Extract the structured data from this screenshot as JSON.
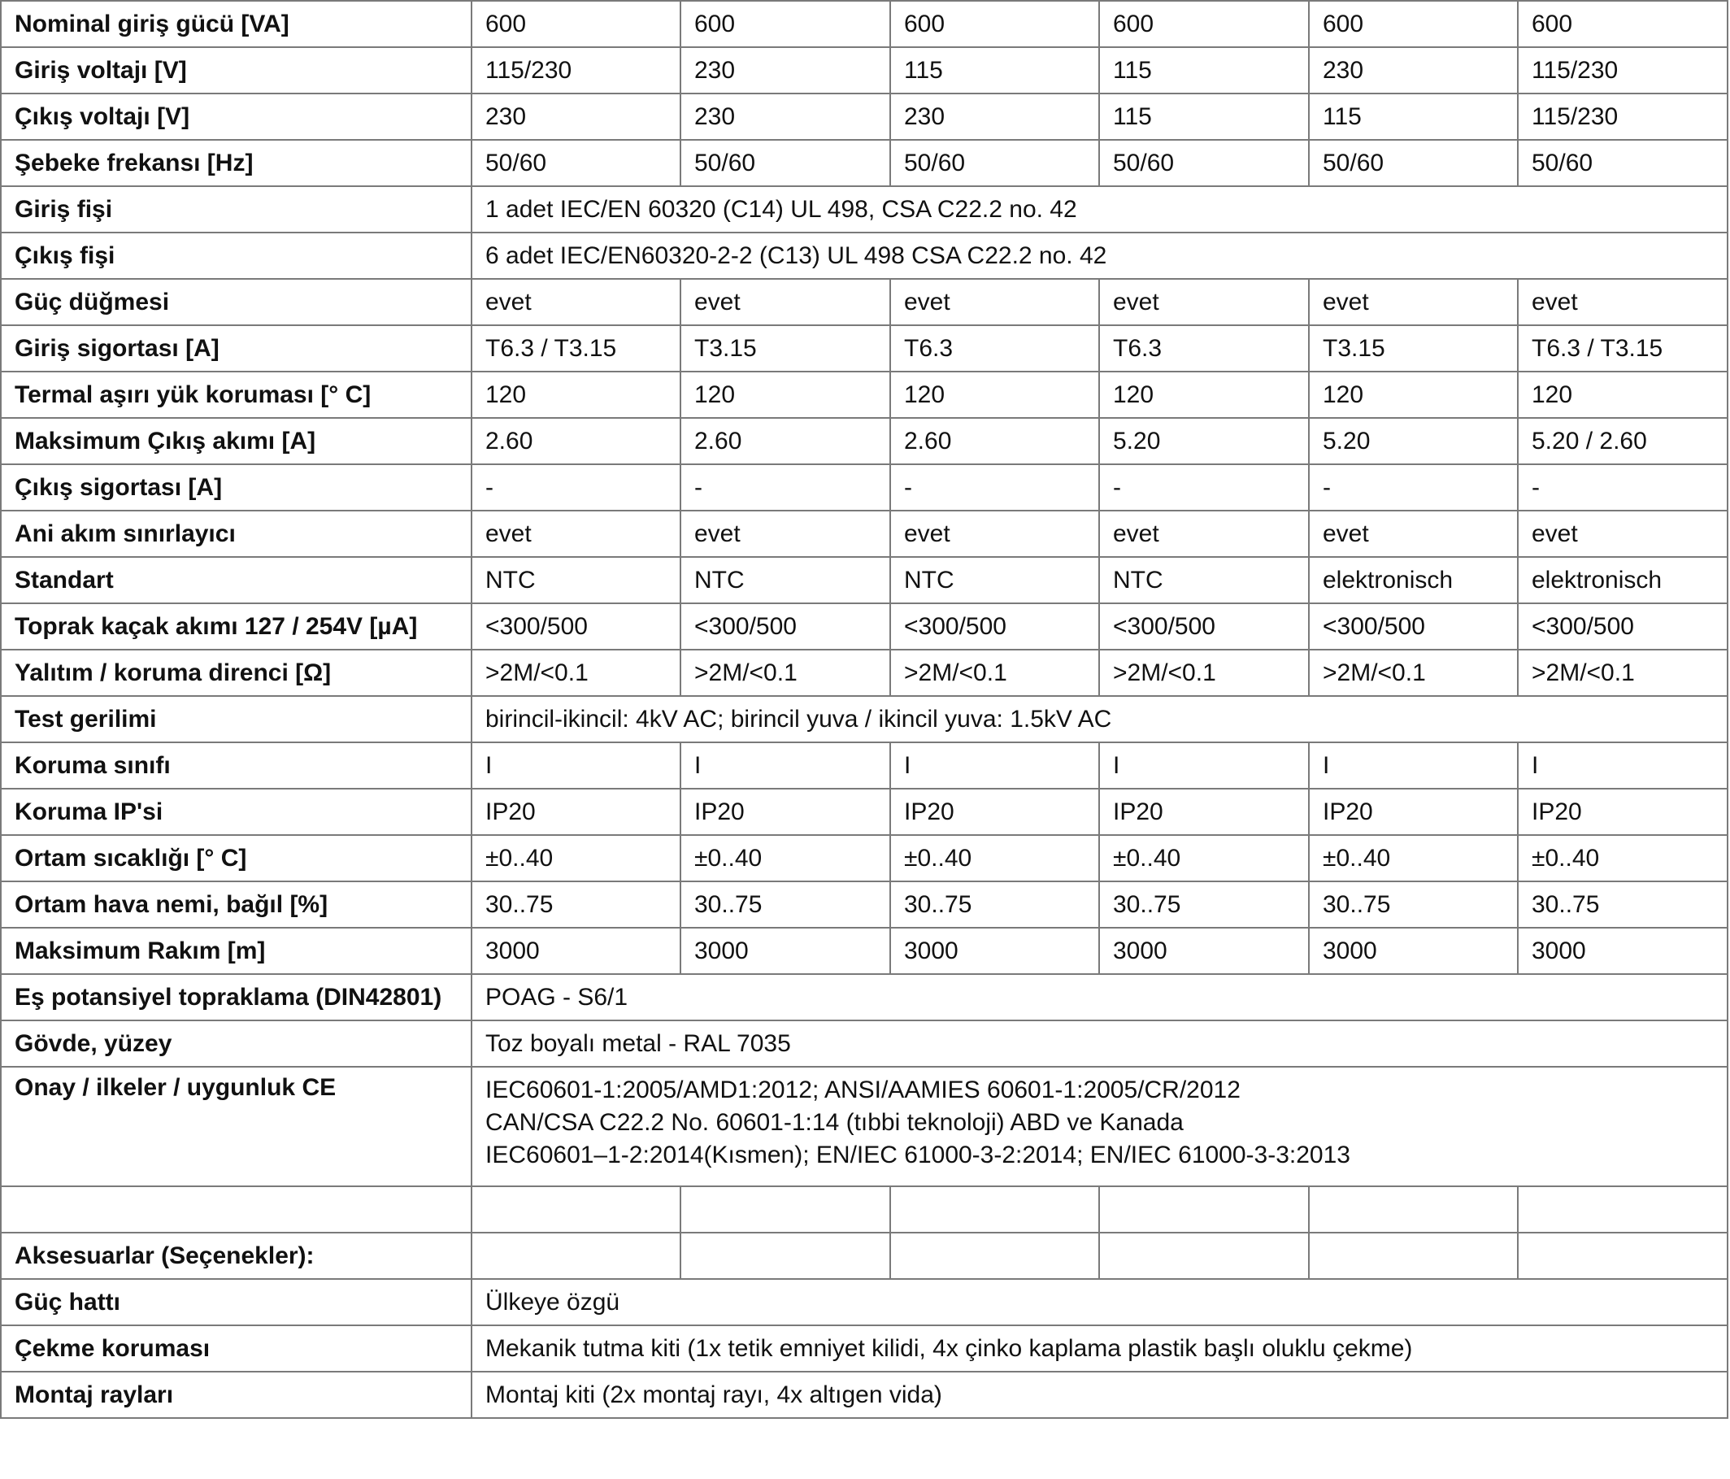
{
  "rows": [
    {
      "label": "Nominal giriş gücü [VA]",
      "values": [
        "600",
        "600",
        "600",
        "600",
        "600",
        "600"
      ]
    },
    {
      "label": "Giriş voltajı [V]",
      "values": [
        "115/230",
        "230",
        "115",
        "115",
        "230",
        "115/230"
      ]
    },
    {
      "label": "Çıkış voltajı [V]",
      "values": [
        "230",
        "230",
        "230",
        "115",
        "115",
        "115/230"
      ]
    },
    {
      "label": "Şebeke frekansı [Hz]",
      "values": [
        "50/60",
        "50/60",
        "50/60",
        "50/60",
        "50/60",
        "50/60"
      ]
    },
    {
      "label": "Giriş fişi",
      "span": "1 adet IEC/EN 60320 (C14) UL 498, CSA C22.2 no. 42"
    },
    {
      "label": "Çıkış fişi",
      "span": "6 adet IEC/EN60320-2-2 (C13) UL 498 CSA C22.2 no. 42"
    },
    {
      "label": "Güç düğmesi",
      "values": [
        "evet",
        "evet",
        "evet",
        "evet",
        "evet",
        "evet"
      ]
    },
    {
      "label": "Giriş sigortası [A]",
      "values": [
        "T6.3 / T3.15",
        "T3.15",
        "T6.3",
        "T6.3",
        "T3.15",
        "T6.3 / T3.15"
      ]
    },
    {
      "label": "Termal aşırı yük koruması [° C]",
      "values": [
        "120",
        "120",
        "120",
        "120",
        "120",
        "120"
      ]
    },
    {
      "label": "Maksimum Çıkış akımı [A]",
      "values": [
        "2.60",
        "2.60",
        "2.60",
        "5.20",
        "5.20",
        "5.20 / 2.60"
      ]
    },
    {
      "label": "Çıkış sigortası [A]",
      "values": [
        "-",
        "-",
        "-",
        "-",
        "-",
        "-"
      ]
    },
    {
      "label": "Ani akım sınırlayıcı",
      "values": [
        "evet",
        "evet",
        "evet",
        "evet",
        "evet",
        "evet"
      ]
    },
    {
      "label": "Standart",
      "values": [
        "NTC",
        "NTC",
        "NTC",
        "NTC",
        "elektronisch",
        "elektronisch"
      ]
    },
    {
      "label": "Toprak kaçak akımı 127 / 254V [µA]",
      "values": [
        "<300/500",
        "<300/500",
        "<300/500",
        "<300/500",
        "<300/500",
        "<300/500"
      ]
    },
    {
      "label": "Yalıtım / koruma direnci [Ω]",
      "values": [
        ">2M/<0.1",
        ">2M/<0.1",
        ">2M/<0.1",
        ">2M/<0.1",
        ">2M/<0.1",
        ">2M/<0.1"
      ]
    },
    {
      "label": "Test gerilimi",
      "span": "birincil-ikincil: 4kV AC; birincil yuva / ikincil yuva: 1.5kV AC"
    },
    {
      "label": "Koruma sınıfı",
      "values": [
        "I",
        "I",
        "I",
        "I",
        "I",
        "I"
      ]
    },
    {
      "label": "Koruma IP'si",
      "values": [
        "IP20",
        "IP20",
        "IP20",
        "IP20",
        "IP20",
        "IP20"
      ]
    },
    {
      "label": "Ortam sıcaklığı [° C]",
      "values": [
        "±0..40",
        "±0..40",
        "±0..40",
        "±0..40",
        "±0..40",
        "±0..40"
      ]
    },
    {
      "label": "Ortam hava nemi, bağıl [%]",
      "values": [
        "30..75",
        "30..75",
        "30..75",
        "30..75",
        "30..75",
        "30..75"
      ]
    },
    {
      "label": "Maksimum Rakım [m]",
      "values": [
        "3000",
        "3000",
        "3000",
        "3000",
        "3000",
        "3000"
      ]
    },
    {
      "label": "Eş potansiyel topraklama (DIN42801)",
      "span": "POAG - S6/1"
    },
    {
      "label": "Gövde, yüzey",
      "span": "Toz boyalı metal - RAL 7035"
    },
    {
      "label": "Onay / ilkeler / uygunluk CE",
      "lines": [
        "IEC60601-1:2005/AMD1:2012; ANSI/AAMIES 60601-1:2005/CR/2012",
        "CAN/CSA C22.2 No. 60601-1:14 (tıbbi teknoloji) ABD ve Kanada",
        "IEC60601–1-2:2014(Kısmen); EN/IEC 61000-3-2:2014; EN/IEC 61000-3-3:2013"
      ]
    },
    {
      "label": "",
      "values": [
        "",
        "",
        "",
        "",
        "",
        ""
      ]
    },
    {
      "label": "Aksesuarlar (Seçenekler):",
      "values": [
        "",
        "",
        "",
        "",
        "",
        ""
      ]
    },
    {
      "label": "Güç hattı",
      "span": "Ülkeye özgü"
    },
    {
      "label": "Çekme koruması",
      "span": "Mekanik tutma kiti (1x tetik emniyet kilidi, 4x çinko kaplama plastik başlı oluklu çekme)"
    },
    {
      "label": "Montaj rayları",
      "span": "Montaj kiti (2x montaj rayı, 4x altıgen vida)"
    }
  ]
}
